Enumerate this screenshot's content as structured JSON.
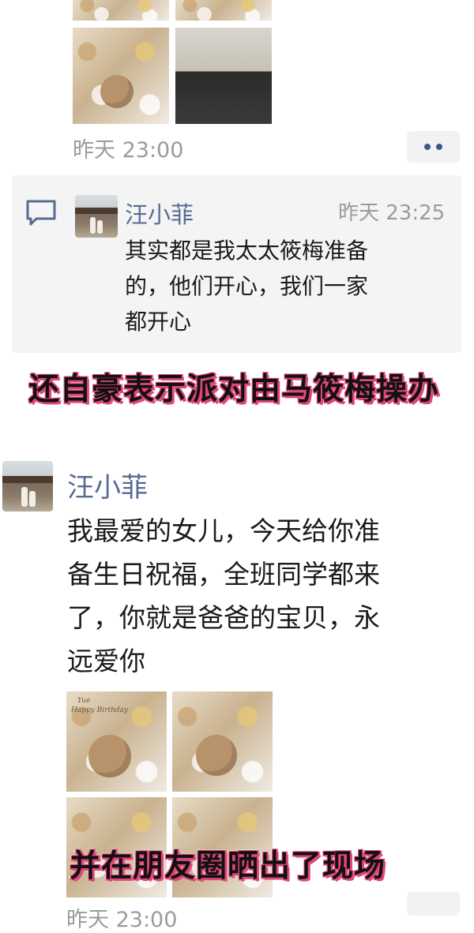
{
  "post_top": {
    "time": "昨天 23:00",
    "more_icon": "ellipsis-icon"
  },
  "comment": {
    "icon": "comment-bubble-icon",
    "author": "汪小菲",
    "time": "昨天 23:25",
    "text_lines": [
      "其实都是我太太筱梅准备",
      "的，他们开心，我们一家",
      "都开心"
    ]
  },
  "caption_top": "还自豪表示派对由马筱梅操办",
  "post_main": {
    "author": "汪小菲",
    "text_lines": [
      "我最爱的女儿，今天给你准",
      "备生日祝福，全班同学都来",
      "了，你就是爸爸的宝贝，永",
      "远爱你"
    ],
    "photo_lines": [
      "Yue",
      "Happy Birthday"
    ],
    "time": "昨天 23:00"
  },
  "caption_bottom": "并在朋友圈晒出了现场",
  "colors": {
    "name": "#566b94",
    "timestamp": "#9b9b9b",
    "caption_outline": "#e0457b"
  }
}
